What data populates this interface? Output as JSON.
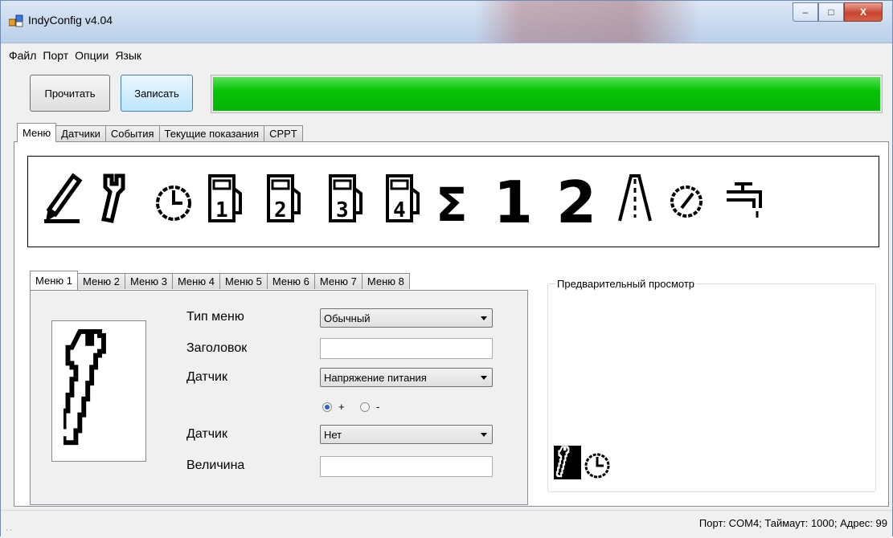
{
  "window": {
    "title": "IndyConfig v4.04",
    "min_glyph": "‒",
    "max_glyph": "□",
    "close_glyph": "X"
  },
  "menu": {
    "items": [
      "Файл",
      "Порт",
      "Опции",
      "Язык"
    ]
  },
  "toolbar": {
    "read_label": "Прочитать",
    "write_label": "Записать",
    "progress_fraction": 1.0,
    "progress_color": "#06c406"
  },
  "main_tabs": [
    "Меню",
    "Датчики",
    "События",
    "Текущие показания",
    "CPPT"
  ],
  "icon_strip": [
    "pen-icon",
    "wrench-icon",
    "clock-icon",
    "fuel-pump-1-icon",
    "fuel-pump-2-icon",
    "fuel-pump-3-icon",
    "fuel-pump-4-icon",
    "sigma-icon",
    "digit-1-icon",
    "digit-2-icon",
    "road-icon",
    "speedometer-icon",
    "faucet-icon"
  ],
  "menu_tabs": [
    "Меню 1",
    "Меню 2",
    "Меню 3",
    "Меню 4",
    "Меню 5",
    "Меню 6",
    "Меню 7",
    "Меню 8"
  ],
  "form": {
    "menu_type_label": "Тип меню",
    "menu_type_value": "Обычный",
    "title_label": "Заголовок",
    "title_value": "",
    "sensor1_label": "Датчик",
    "sensor1_value": "Напряжение питания",
    "radio_plus": "+",
    "radio_minus": "-",
    "sensor2_label": "Датчик",
    "sensor2_value": "Нет",
    "value_label": "Величина",
    "value_value": ""
  },
  "preview": {
    "title": "Предварительный просмотр",
    "icons": [
      "wrench-icon",
      "clock-icon"
    ]
  },
  "status": {
    "text": "Порт: COM4;  Таймаут: 1000;  Адрес: 99"
  }
}
